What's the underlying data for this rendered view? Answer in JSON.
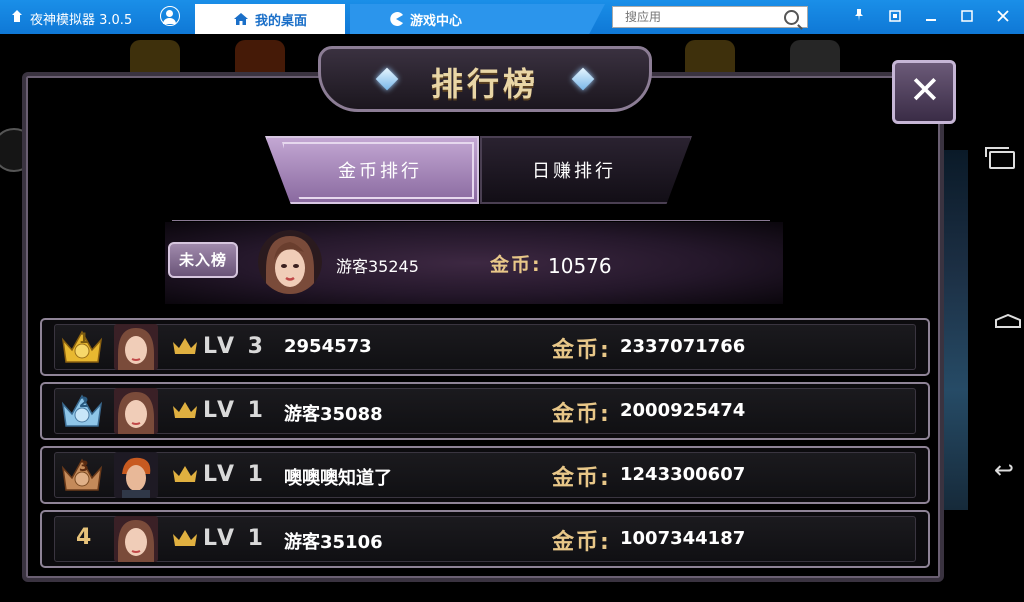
{
  "emulator": {
    "title": "夜神模拟器 3.0.5",
    "tabs": [
      {
        "label": "我的桌面",
        "active": true
      },
      {
        "label": "游戏中心",
        "active": false
      }
    ],
    "search": {
      "placeholder": "搜应用"
    },
    "window_buttons": [
      "pin",
      "restore",
      "minimize",
      "maximize",
      "close"
    ]
  },
  "dialog": {
    "title": "排行榜",
    "tabs": [
      {
        "label": "金币排行",
        "active": true
      },
      {
        "label": "日赚排行",
        "active": false
      }
    ],
    "self": {
      "badge": "未入榜",
      "name": "游客35245",
      "coin_label": "金币:",
      "coin_value": "10576"
    },
    "rankings": [
      {
        "rank": "1",
        "medal": "gold",
        "level": "LV 3",
        "name": "2954573",
        "coin_label": "金币:",
        "coins": "2337071766"
      },
      {
        "rank": "2",
        "medal": "silver",
        "level": "LV 1",
        "name": "游客35088",
        "coin_label": "金币:",
        "coins": "2000925474"
      },
      {
        "rank": "3",
        "medal": "bronze",
        "level": "LV 1",
        "name": "噢噢噢知道了",
        "coin_label": "金币:",
        "coins": "1243300607"
      },
      {
        "rank": "4",
        "medal": "none",
        "level": "LV 1",
        "name": "游客35106",
        "coin_label": "金币:",
        "coins": "1007344187"
      }
    ]
  },
  "colors": {
    "emulator_blue": "#1a8fe8",
    "gold_text": "#e8c788",
    "panel_border": "#8f8497",
    "tab_active": "#a98cbb"
  }
}
